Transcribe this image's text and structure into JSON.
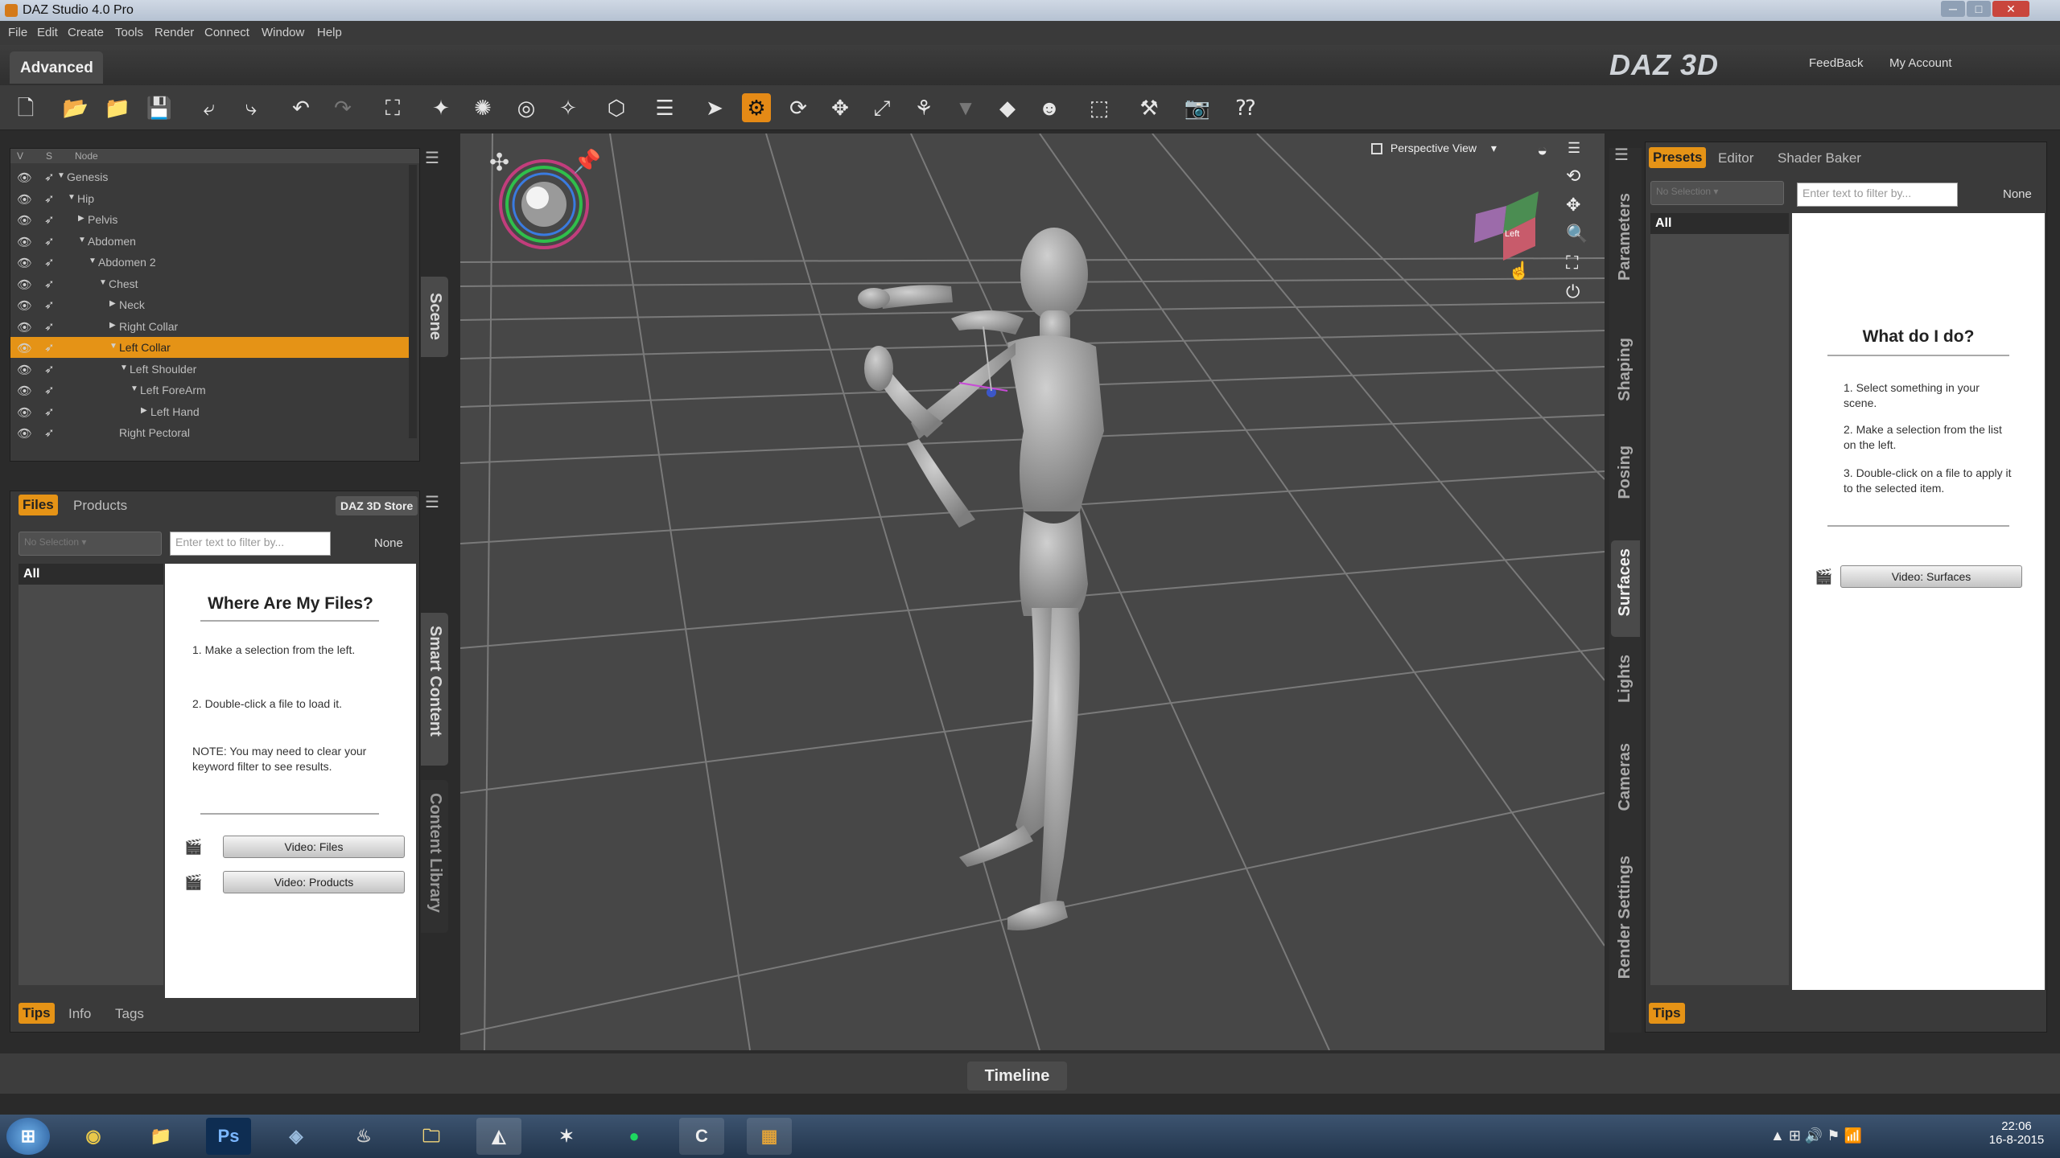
{
  "window": {
    "title": "DAZ Studio 4.0 Pro"
  },
  "menu": [
    "File",
    "Edit",
    "Create",
    "Tools",
    "Render",
    "Connect",
    "Window",
    "Help"
  ],
  "mode_tab": "Advanced",
  "brand": {
    "logo": "DAZ 3D",
    "feedback": "FeedBack",
    "account": "My Account"
  },
  "scene": {
    "col_v": "V",
    "col_s": "S",
    "col_node": "Node",
    "tab": "Scene",
    "nodes": [
      {
        "label": "Genesis",
        "level": 0,
        "arrow": "▼"
      },
      {
        "label": "Hip",
        "level": 1,
        "arrow": "▼"
      },
      {
        "label": "Pelvis",
        "level": 2,
        "arrow": "▶"
      },
      {
        "label": "Abdomen",
        "level": 2,
        "arrow": "▼"
      },
      {
        "label": "Abdomen 2",
        "level": 3,
        "arrow": "▼"
      },
      {
        "label": "Chest",
        "level": 4,
        "arrow": "▼"
      },
      {
        "label": "Neck",
        "level": 5,
        "arrow": "▶"
      },
      {
        "label": "Right Collar",
        "level": 5,
        "arrow": "▶"
      },
      {
        "label": "Left Collar",
        "level": 5,
        "arrow": "▼",
        "selected": true
      },
      {
        "label": "Left Shoulder",
        "level": 6,
        "arrow": "▼"
      },
      {
        "label": "Left ForeArm",
        "level": 7,
        "arrow": "▼"
      },
      {
        "label": "Left Hand",
        "level": 8,
        "arrow": "▶"
      },
      {
        "label": "Right Pectoral",
        "level": 5,
        "arrow": ""
      }
    ]
  },
  "files": {
    "tab_files": "Files",
    "tab_products": "Products",
    "store": "DAZ 3D Store",
    "dropdown": "No Selection",
    "filter_placeholder": "Enter text to filter by...",
    "none": "None",
    "all": "All",
    "heading": "Where Are My Files?",
    "step1": "1. Make a selection from the left.",
    "step2": "2. Double-click a file to load it.",
    "note": "NOTE: You may need to clear your keyword filter to see results.",
    "video_files": "Video: Files",
    "video_products": "Video: Products",
    "side_tab_smart": "Smart Content",
    "side_tab_library": "Content Library",
    "tips": "Tips",
    "info": "Info",
    "tags": "Tags"
  },
  "viewport": {
    "view_label": "Perspective View",
    "cube_face": "Left"
  },
  "right": {
    "tab_presets": "Presets",
    "tab_editor": "Editor",
    "tab_shader": "Shader Baker",
    "dropdown": "No Selection",
    "filter_placeholder": "Enter text to filter by...",
    "none": "None",
    "all": "All",
    "heading": "What do I do?",
    "step1": "1. Select something in your scene.",
    "step2": "2. Make a selection from the list on the left.",
    "step3": "3. Double-click on a file to apply it to the selected item.",
    "video": "Video: Surfaces",
    "tips": "Tips",
    "side_tabs": [
      "Parameters",
      "Shaping",
      "Posing",
      "Surfaces",
      "Lights",
      "Cameras",
      "Render Settings"
    ]
  },
  "timeline": "Timeline",
  "clock": {
    "time": "22:06",
    "date": "16-8-2015"
  },
  "taskbar_apps": [
    "Start",
    "Chrome",
    "Explorer",
    "Photoshop",
    "App",
    "Steam",
    "Folder",
    "DAZ Studio",
    "Poser",
    "Spotify",
    "Editor",
    "Archive"
  ],
  "colors": {
    "accent": "#e59316",
    "panel": "#3a3a3a",
    "viewport": "#474747"
  }
}
